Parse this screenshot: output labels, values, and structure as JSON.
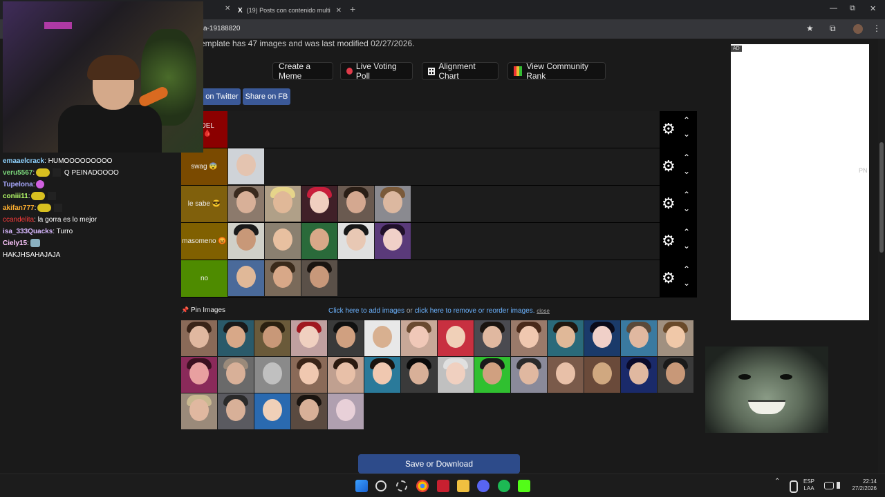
{
  "browser": {
    "tab2_icon": "X",
    "tab2_title": "(19) Posts con contenido multi",
    "close_glyph": "✕",
    "new_tab_glyph": "+",
    "url": "a-19188820",
    "window_minimize": "—",
    "window_restore": "⧉",
    "window_close": "✕"
  },
  "page": {
    "info_text": "emplate has 47 images and was last modified 02/27/2026.",
    "buttons": {
      "create_meme": "Create a Meme",
      "live_voting": "Live Voting Poll",
      "alignment_chart": "Alignment Chart",
      "community_rank": "View Community Rank"
    },
    "share_twitter": "on Twitter",
    "share_fb": "Share on FB",
    "tiers": [
      {
        "label": "S DEL\nP 🩸",
        "color": "#8b0000"
      },
      {
        "label": "swag 😨",
        "color": "#7a4a00"
      },
      {
        "label": "le sabe 😎",
        "color": "#80600c"
      },
      {
        "label": "masomeno 😡",
        "color": "#806000"
      },
      {
        "label": "no",
        "color": "#4e8b00"
      }
    ],
    "gear_glyph": "⚙",
    "up_glyph": "⌃",
    "down_glyph": "⌄",
    "pin_images_label": "Pin Images",
    "pin_icon": "📌",
    "add_images_link": "Click here to add images",
    "or_text": " or ",
    "reorder_link": "click here to remove or reorder images.",
    "close_link": "close",
    "save_button": "Save or Download",
    "ad_label": "AD",
    "ad_fragment": "PN"
  },
  "chat": [
    {
      "user": "emaaelcrack",
      "color": "#8fd3ff",
      "msg": ": HUMOOOOOOOOO",
      "emote": false
    },
    {
      "user": "veru5567",
      "color": "#7cd97c",
      "msg": " Q PEINADOOOO",
      "emote": true
    },
    {
      "user": "Tupelona",
      "color": "#a9a9ff",
      "msg": ":",
      "emote": true
    },
    {
      "user": "coniii11",
      "color": "#b8ff6a",
      "msg": ":",
      "emote": true
    },
    {
      "user": "akifan777",
      "color": "#ffb030",
      "msg": ":",
      "emote": true
    },
    {
      "user": "ccandelita",
      "color": "#ff3b3b",
      "msg": ": la gorra es lo mejor",
      "emote": false
    },
    {
      "user": "isa_333Quacks",
      "color": "#d8b8ff",
      "msg": ": Turro",
      "emote": false
    },
    {
      "user": "Ciely15",
      "color": "#ffc8ff",
      "msg": ":",
      "emote": true
    },
    {
      "user": "",
      "color": "#ffffff",
      "msg": "HAKJHSAHAJAJA",
      "emote": false
    }
  ],
  "taskbar": {
    "lang_top": "ESP",
    "lang_bottom": "LAA",
    "time": "22:14",
    "date": "27/2/2026",
    "tray_arrow": "⌃"
  },
  "colors": {
    "tier_bg": "#1c1c1c",
    "link": "#6cb3ff",
    "save_button_bg": "#2d4b8a",
    "share_bg": "#3b5998"
  }
}
